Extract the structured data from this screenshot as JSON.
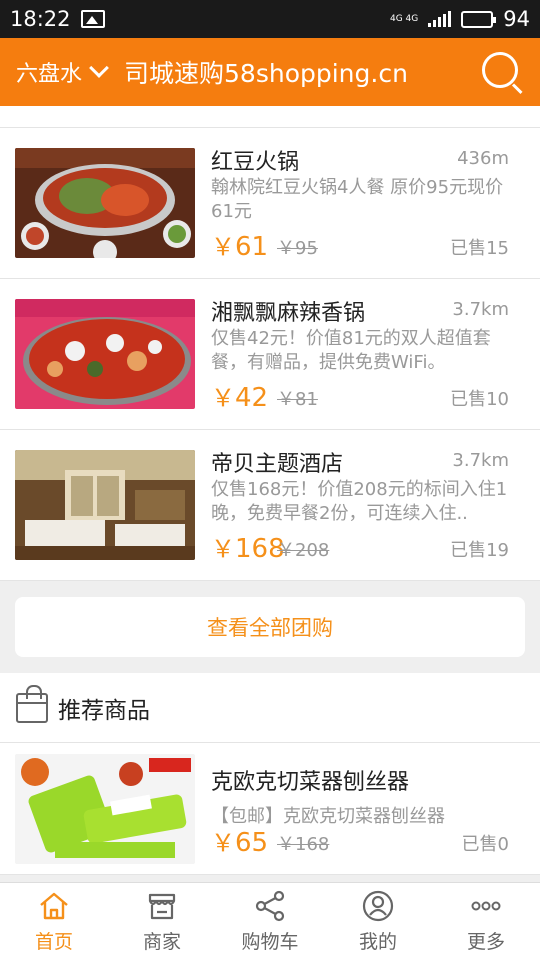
{
  "status_bar": {
    "time": "18:22",
    "network": "4G 4G",
    "battery": "94"
  },
  "header": {
    "city": "六盘水",
    "title": "司城速购58shopping.cn",
    "search_icon": "search-icon"
  },
  "deals": [
    {
      "name": "红豆火锅",
      "distance": "436m",
      "desc": "翰林院红豆火锅4人餐  原价95元现价61元",
      "currency": "￥",
      "price": "61",
      "original": "￥95",
      "sold": "已售15"
    },
    {
      "name": "湘飘飘麻辣香锅",
      "distance": "3.7km",
      "desc": "仅售42元！价值81元的双人超值套餐，有赠品，提供免费WiFi。",
      "currency": "￥",
      "price": "42",
      "original": "￥81",
      "sold": "已售10"
    },
    {
      "name": "帝贝主题酒店",
      "distance": "3.7km",
      "desc": "仅售168元！价值208元的标间入住1晚，免费早餐2份，可连续入住..",
      "currency": "￥",
      "price": "168",
      "original": "￥208",
      "sold": "已售19"
    }
  ],
  "view_all": "查看全部团购",
  "recommend": {
    "title": "推荐商品",
    "icon": "shopping-bag-icon"
  },
  "products": [
    {
      "name": "克欧克切菜器刨丝器",
      "desc": "【包邮】克欧克切菜器刨丝器",
      "currency": "￥",
      "price": "65",
      "original": "￥168",
      "sold": "已售0"
    }
  ],
  "nav": {
    "items": [
      {
        "label": "首页",
        "icon": "home-icon",
        "active": true
      },
      {
        "label": "商家",
        "icon": "store-icon",
        "active": false
      },
      {
        "label": "购物车",
        "icon": "share-icon",
        "active": false
      },
      {
        "label": "我的",
        "icon": "user-icon",
        "active": false
      },
      {
        "label": "更多",
        "icon": "more-icon",
        "active": false
      }
    ]
  },
  "colors": {
    "accent": "#f57d0f",
    "price": "#f5901a"
  }
}
